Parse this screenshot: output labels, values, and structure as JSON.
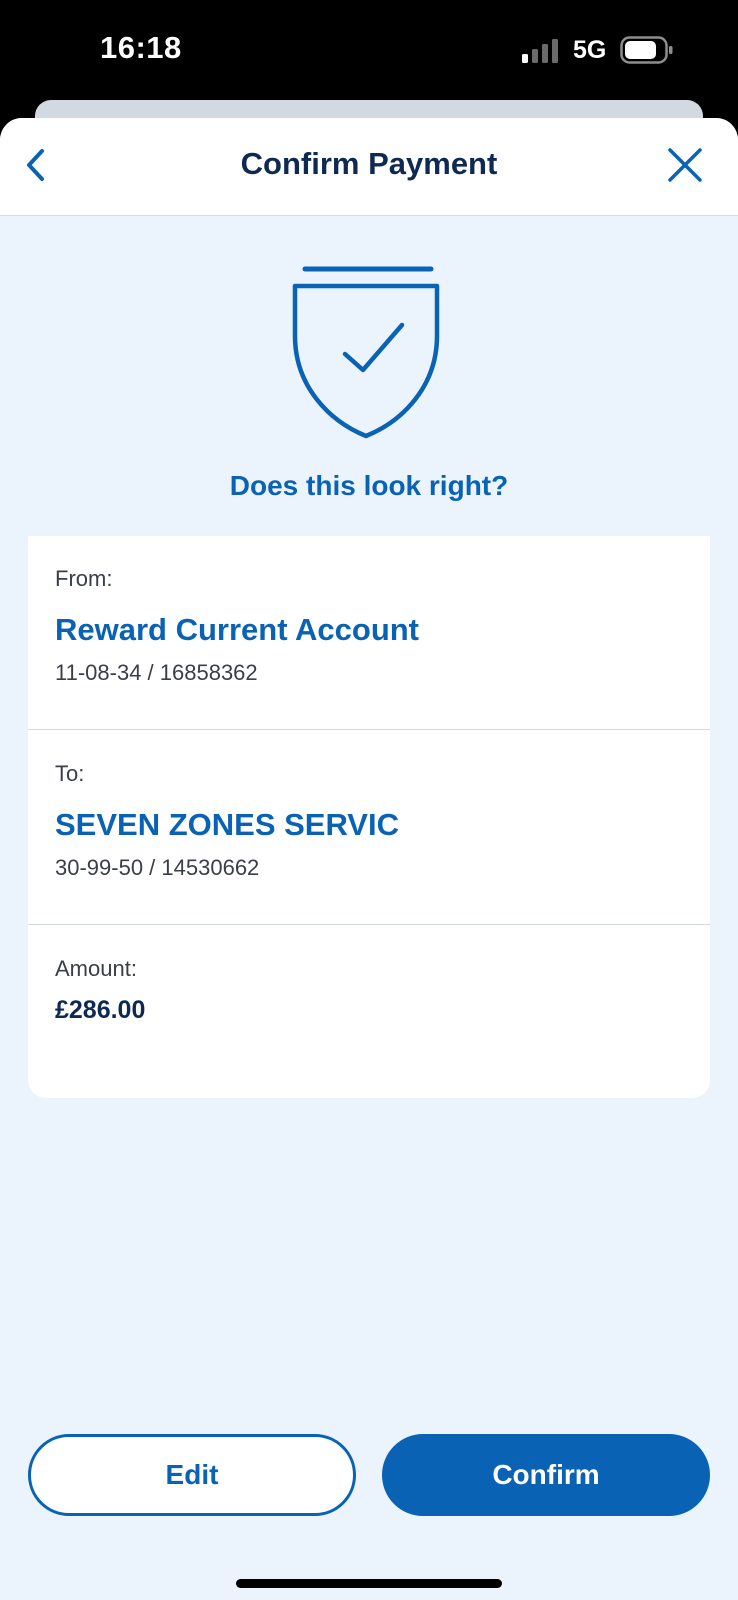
{
  "status_bar": {
    "time": "16:18",
    "network": "5G",
    "icons": [
      "signal-icon",
      "battery-icon"
    ]
  },
  "nav": {
    "title": "Confirm Payment",
    "back_icon": "chevron-left-icon",
    "close_icon": "close-icon"
  },
  "hero": {
    "icon": "shield-check-icon",
    "headline": "Does this look right?"
  },
  "details": {
    "from": {
      "label": "From:",
      "name": "Reward Current Account",
      "account": "11-08-34 / 16858362"
    },
    "to": {
      "label": "To:",
      "name": "SEVEN ZONES SERVIC",
      "account": "30-99-50 / 14530662"
    },
    "amount": {
      "label": "Amount:",
      "value": "£286.00"
    }
  },
  "actions": {
    "edit_label": "Edit",
    "confirm_label": "Confirm"
  },
  "colors": {
    "accent": "#0a62b5",
    "title": "#0e2a52",
    "background": "#ebf4fd",
    "card": "#ffffff"
  }
}
